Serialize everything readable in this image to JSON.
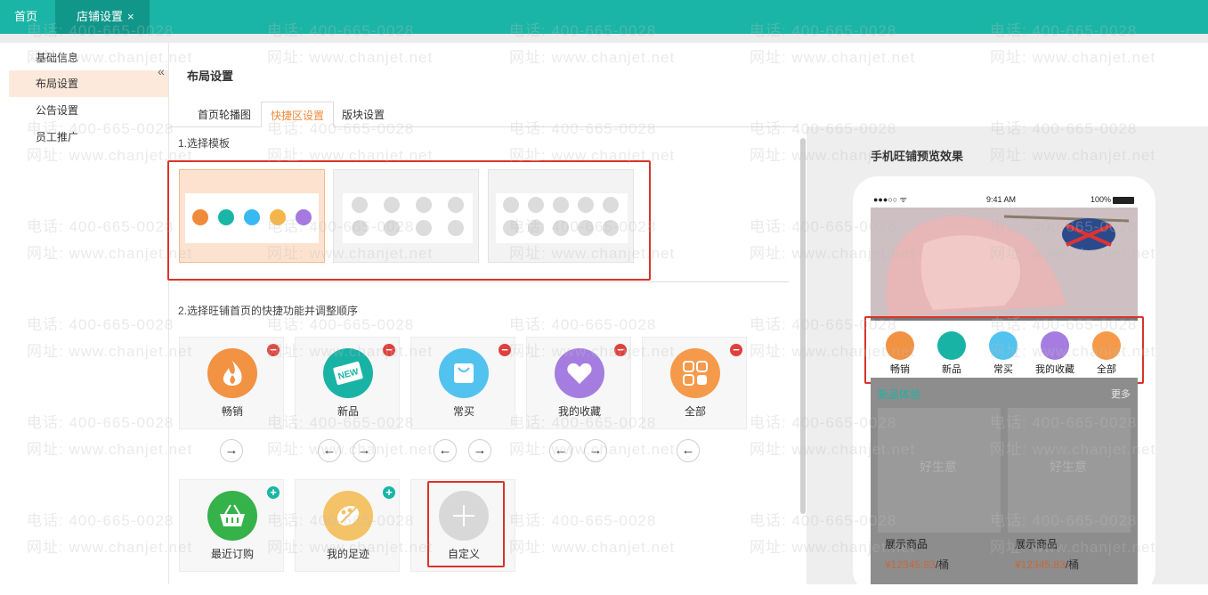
{
  "tabs": {
    "home": "首页",
    "shop": "店铺设置",
    "close": "×"
  },
  "sidebar": {
    "items": [
      {
        "label": "基础信息"
      },
      {
        "label": "布局设置"
      },
      {
        "label": "公告设置"
      },
      {
        "label": "员工推广"
      }
    ],
    "collapse": "«"
  },
  "page": {
    "title": "布局设置"
  },
  "subtabs": [
    {
      "label": "首页轮播图"
    },
    {
      "label": "快捷区设置"
    },
    {
      "label": "版块设置"
    }
  ],
  "step1": {
    "label": "1.选择模板"
  },
  "step2": {
    "label": "2.选择旺铺首页的快捷功能并调整顺序"
  },
  "templates": {
    "selected_dot_colors": [
      "#f08a3c",
      "#1ab5a6",
      "#39b9f1",
      "#f5b548",
      "#a678e2"
    ]
  },
  "quick_items": [
    {
      "label": "畅销",
      "icon": "flame-icon",
      "color": "#f29243"
    },
    {
      "label": "新品",
      "icon": "new-badge-icon",
      "color": "#19b3a5"
    },
    {
      "label": "常买",
      "icon": "shopping-bag-icon",
      "color": "#52c3ee"
    },
    {
      "label": "我的收藏",
      "icon": "heart-icon",
      "color": "#a57de0"
    },
    {
      "label": "全部",
      "icon": "grid-icon",
      "color": "#f59a4a"
    }
  ],
  "extra_items": [
    {
      "label": "最近订购",
      "icon": "basket-icon",
      "color": "#35b24a"
    },
    {
      "label": "我的足迹",
      "icon": "footprint-icon",
      "color": "#f4c267"
    },
    {
      "label": "自定义",
      "icon": "plus-icon",
      "color": "#d8d8d8"
    }
  ],
  "preview": {
    "title": "手机旺铺预览效果",
    "status": {
      "signal": "●●●○○ ᯤ",
      "time": "9:41 AM",
      "battery": "100%"
    },
    "section_title": "新品体验",
    "more": "更多",
    "product_name": "展示商品",
    "product_price": "¥12345.83",
    "product_unit": "/桶",
    "product_logo": "好生意"
  },
  "watermark": {
    "phone": "电话: 400-665-0028",
    "site": "网址: www.chanjet.net"
  },
  "colors": {
    "accent": "#1ab5a6",
    "tab_active": "#f08a3c",
    "highlight": "#d9342a"
  }
}
